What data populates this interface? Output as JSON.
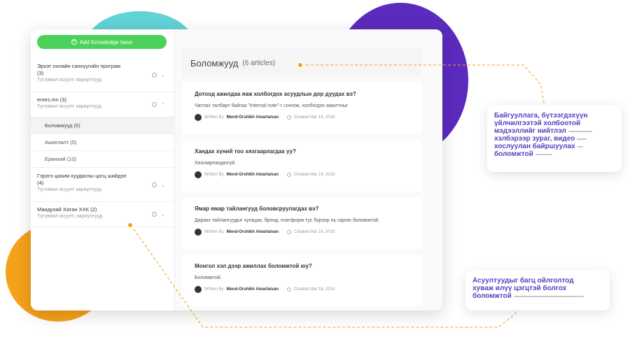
{
  "sidebar": {
    "add_button": "Add Knowledge base",
    "items": [
      {
        "title": "Эрхэт онлайн санхүүгийн програм",
        "count": "(3)",
        "subtitle": "Түгээмэл асуулт хариултууд",
        "chevron": "⌄"
      },
      {
        "title": "erxes.mn (3)",
        "count": "",
        "subtitle": "Түгээмэл асуулт хариултууд",
        "chevron": "⌃"
      },
      {
        "title": "Гэрэгэ цахим хуудасны цогц шийдэл",
        "count": "(4)",
        "subtitle": "Түгээмэл асуулт хариултууд",
        "chevron": "⌄"
      },
      {
        "title": "Мандухай Хатан ХХК (2)",
        "count": "",
        "subtitle": "Түгээмэл асуулт, хариултууд",
        "chevron": "⌄"
      }
    ],
    "subitems": [
      {
        "label": "Боломжууд (6)"
      },
      {
        "label": "Ашиглалт (5)"
      },
      {
        "label": "Ерөнхий (10)"
      }
    ]
  },
  "content": {
    "title": "Боломжууд",
    "count": "(6 articles)",
    "articles": [
      {
        "title": "Дотоод ажилдаа яаж холбогдох асуудлын дор дуудах вэ?",
        "body": "Чатлах талбарт байгаа \"Internal note\"-г сонгож, холбогдох ажилтныг",
        "written_by": "Written By",
        "author": "Mend-Orshikh Amartaivan",
        "created": "Created Mar 16, 2018"
      },
      {
        "title": "Хандах хүний тоо хязгаарлагдах уу?",
        "body": "Хязгаарлагдахгүй.",
        "written_by": "Written By",
        "author": "Mend-Orshikh Amartaivan",
        "created": "Created Mar 16, 2018"
      },
      {
        "title": "Ямар ямар тайлангууд боловсруулагдах вэ?",
        "body": "Даракх тайлангуудыг хугацаа, брэнд, платформ тус бүрээр нь гаргах боломжтой.",
        "written_by": "Written By",
        "author": "Mend-Orshikh Amartaivan",
        "created": "Created Mar 16, 2018"
      },
      {
        "title": "Монгол хэл дээр ажиллах боломжтой юу?",
        "body": "Боломжтой.",
        "written_by": "Written By",
        "author": "Mend-Orshikh Amartaivan",
        "created": "Created Mar 16, 2018"
      }
    ]
  },
  "callouts": {
    "top": [
      "Байгууллага, бүтээгдэхүүн",
      "үйлчилгээтэй холбоотой",
      "мэдээллийг нийтлэл",
      "хэлбэрээр зураг, видео",
      "хослуулан байршуулах",
      "боломжтой"
    ],
    "bottom": [
      "Асуултуудыг багц ойлголтод",
      "хуваж илүү цэгцтэй болгох",
      "боломжтой"
    ]
  },
  "colors": {
    "accent_green": "#4cd15a",
    "callout_text": "#5a3fc0",
    "dot_orange": "#f4a21a",
    "blob_purple": "#5b2bbd",
    "blob_teal": "#62d2d6"
  }
}
